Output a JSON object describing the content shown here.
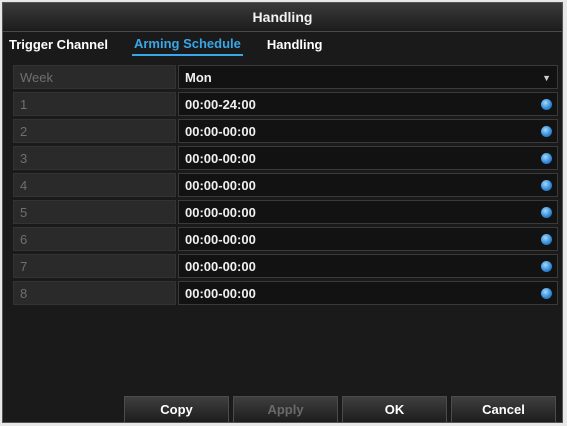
{
  "window": {
    "title": "Handling"
  },
  "tabs": [
    {
      "label": "Trigger Channel"
    },
    {
      "label": "Arming Schedule"
    },
    {
      "label": "Handling"
    }
  ],
  "week": {
    "label": "Week",
    "value": "Mon"
  },
  "schedule": [
    {
      "index": "1",
      "time": "00:00-24:00"
    },
    {
      "index": "2",
      "time": "00:00-00:00"
    },
    {
      "index": "3",
      "time": "00:00-00:00"
    },
    {
      "index": "4",
      "time": "00:00-00:00"
    },
    {
      "index": "5",
      "time": "00:00-00:00"
    },
    {
      "index": "6",
      "time": "00:00-00:00"
    },
    {
      "index": "7",
      "time": "00:00-00:00"
    },
    {
      "index": "8",
      "time": "00:00-00:00"
    }
  ],
  "buttons": {
    "copy": "Copy",
    "apply": "Apply",
    "ok": "OK",
    "cancel": "Cancel"
  },
  "icons": {
    "edit": "edit-icon",
    "dropdown": "chevron-down-icon"
  },
  "colors": {
    "accent": "#39a6e8",
    "background": "#1a1a1a"
  }
}
